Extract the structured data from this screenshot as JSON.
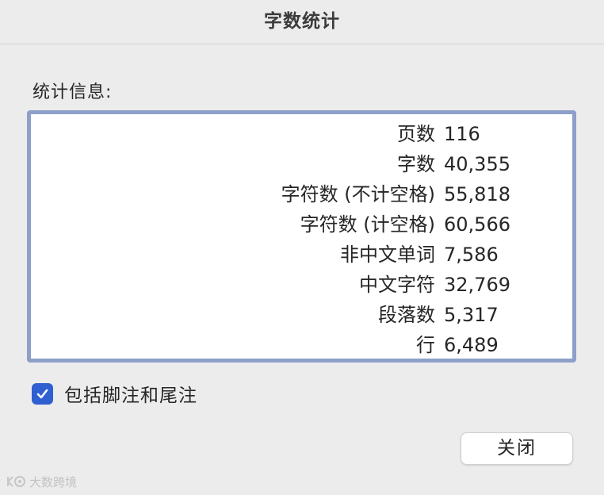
{
  "window": {
    "title": "字数统计"
  },
  "section_label": "统计信息:",
  "stats": [
    {
      "label": "页数",
      "value": "116"
    },
    {
      "label": "字数",
      "value": "40,355"
    },
    {
      "label": "字符数 (不计空格)",
      "value": "55,818"
    },
    {
      "label": "字符数 (计空格)",
      "value": "60,566"
    },
    {
      "label": "非中文单词",
      "value": "7,586"
    },
    {
      "label": "中文字符",
      "value": "32,769"
    },
    {
      "label": "段落数",
      "value": "5,317"
    },
    {
      "label": "行",
      "value": "6,489"
    }
  ],
  "include_footnotes": {
    "label": "包括脚注和尾注",
    "checked": true
  },
  "close_button_label": "关闭",
  "watermark_text": "大数跨境",
  "colors": {
    "accent": "#2f5fd0",
    "box_border": "#8e9fca",
    "background": "#ececec"
  },
  "icons": {
    "checkbox": "checkmark-icon",
    "watermark": "watermark-logo-icon"
  }
}
